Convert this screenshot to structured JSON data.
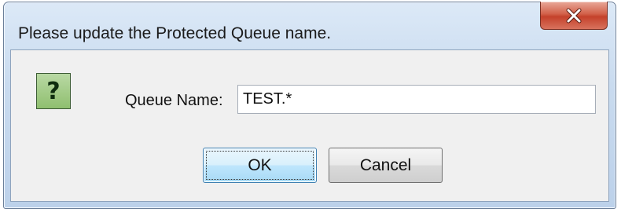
{
  "dialog": {
    "title": "Please update the Protected Queue name.",
    "close_label": "x"
  },
  "form": {
    "icon": "question-icon",
    "icon_glyph": "?",
    "label": "Queue Name:",
    "queue_name_value": "TEST.*"
  },
  "buttons": {
    "ok_label": "OK",
    "cancel_label": "Cancel"
  }
}
